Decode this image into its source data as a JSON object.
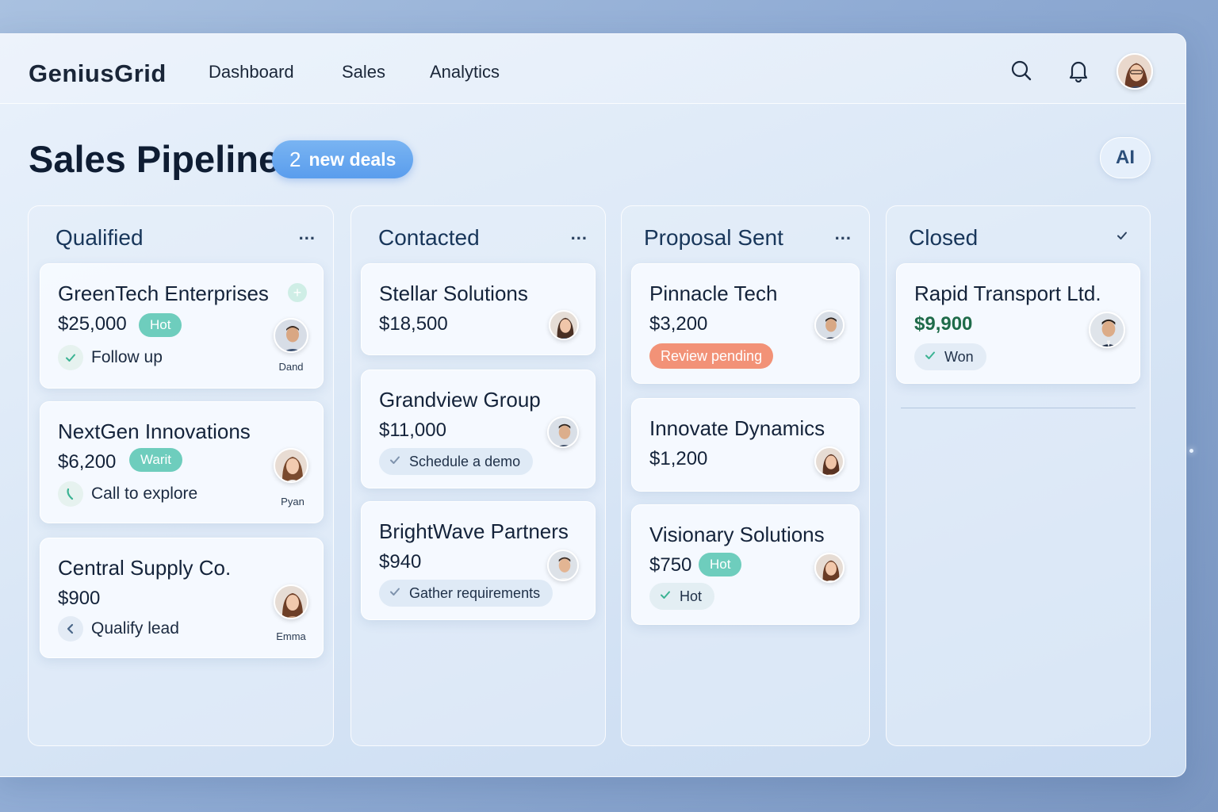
{
  "app": {
    "brand": "GeniusGrid"
  },
  "nav": [
    {
      "label": "Dashboard"
    },
    {
      "label": "Sales"
    },
    {
      "label": "Analytics"
    }
  ],
  "header": {
    "title": "Sales Pipeline",
    "badge_count": "2",
    "badge_text": "new deals",
    "ai_label": "AI"
  },
  "icons": {
    "search": "search-icon",
    "notifications": "bell-icon",
    "menu": "more-horizontal-icon",
    "check": "check-icon"
  },
  "colors": {
    "accent": "#5a9ded",
    "tag_teal": "#6ecdbd",
    "tag_orange": "#f29277",
    "won_text": "#1f6b4a"
  },
  "columns": [
    {
      "title": "Qualified",
      "menu": "...",
      "cards": [
        {
          "name": "GreenTech Enterprises",
          "amount": "$25,000",
          "tag": "Hot",
          "task": "Follow up",
          "owner": "Dand"
        },
        {
          "name": "NextGen Innovations",
          "amount": "$6,200",
          "tag": "Warit",
          "task": "Call to explore",
          "owner": "Pyan"
        },
        {
          "name": "Central Supply Co.",
          "amount": "$900",
          "task": "Qualify lead",
          "owner": "Emma"
        }
      ]
    },
    {
      "title": "Contacted",
      "menu": "...",
      "cards": [
        {
          "name": "Stellar Solutions",
          "amount": "$18,500"
        },
        {
          "name": "Grandview Group",
          "amount": "$11,000",
          "task": "Schedule a demo"
        },
        {
          "name": "BrightWave Partners",
          "amount": "$940",
          "task": "Gather requirements"
        }
      ]
    },
    {
      "title": "Proposal Sent",
      "menu": "...",
      "cards": [
        {
          "name": "Pinnacle Tech",
          "amount": "$3,200",
          "tag": "Review pending"
        },
        {
          "name": "Innovate Dynamics",
          "amount": "$1,200"
        },
        {
          "name": "Visionary Solutions",
          "amount": "$750",
          "tag": "Hot",
          "task": "Hot"
        }
      ]
    },
    {
      "title": "Closed",
      "cards": [
        {
          "name": "Rapid Transport Ltd.",
          "amount": "$9,900",
          "task": "Won"
        }
      ]
    }
  ]
}
